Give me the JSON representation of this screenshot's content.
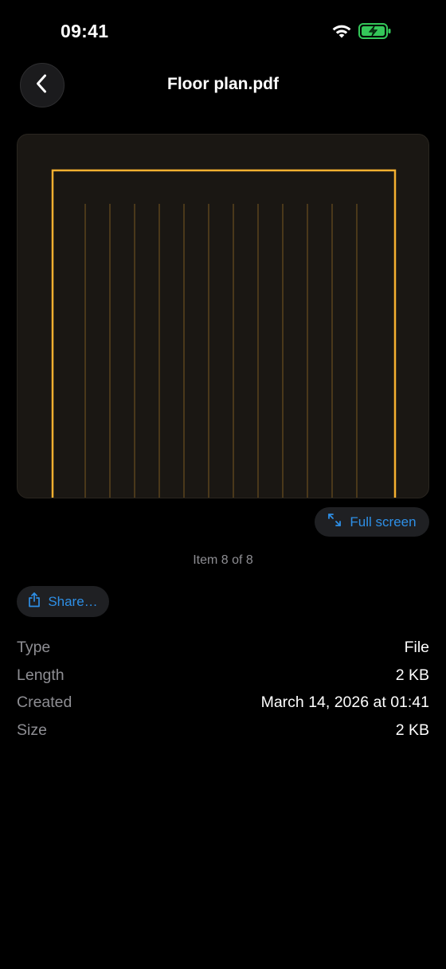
{
  "status_bar": {
    "time": "09:41"
  },
  "header": {
    "title": "Floor plan.pdf",
    "back_icon": "chevron-left-icon"
  },
  "preview": {
    "frame_color": "#f5b030",
    "grid_line_color": "#7a5a22",
    "background_color": "#1a1713"
  },
  "fullscreen": {
    "label": "Full screen",
    "icon": "expand-arrows-icon"
  },
  "item_counter": "Item 8 of 8",
  "share": {
    "label": "Share…",
    "icon": "share-icon"
  },
  "details": [
    {
      "label": "Type",
      "value": "File"
    },
    {
      "label": "Length",
      "value": "2 KB"
    },
    {
      "label": "Created",
      "value": "March 14, 2026 at 01:41"
    },
    {
      "label": "Size",
      "value": "2 KB"
    }
  ],
  "colors": {
    "accent": "#2e8fe6",
    "secondary_text": "#8e8e93",
    "battery_green": "#34c759"
  }
}
